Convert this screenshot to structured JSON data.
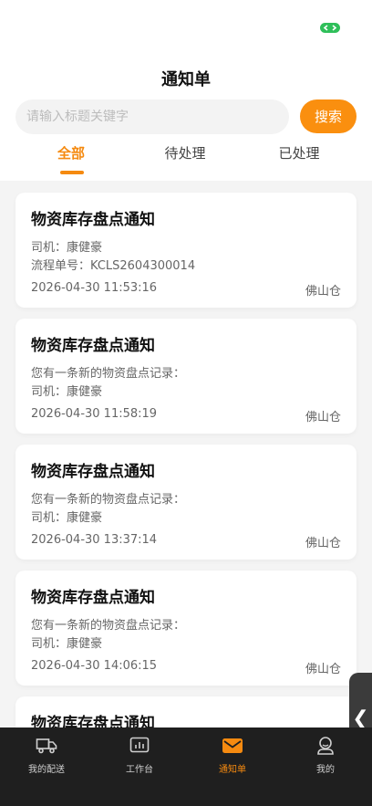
{
  "nav": {
    "title": "通知单"
  },
  "search": {
    "placeholder": "请输入标题关键字",
    "value": "",
    "button_label": "搜索"
  },
  "tabs": [
    {
      "label": "全部",
      "active": true
    },
    {
      "label": "待处理",
      "active": false
    },
    {
      "label": "已处理",
      "active": false
    }
  ],
  "cards": [
    {
      "title": "物资库存盘点通知",
      "line1": "司机：康健豪",
      "line2": "流程单号：KCLS2604300014",
      "time": "2026-04-30 11:53:16",
      "warehouse": "佛山仓"
    },
    {
      "title": "物资库存盘点通知",
      "line1": "您有一条新的物资盘点记录：",
      "line2": "司机：康健豪",
      "time": "2026-04-30 11:58:19",
      "warehouse": "佛山仓"
    },
    {
      "title": "物资库存盘点通知",
      "line1": "您有一条新的物资盘点记录：",
      "line2": "司机：康健豪",
      "time": "2026-04-30 13:37:14",
      "warehouse": "佛山仓"
    },
    {
      "title": "物资库存盘点通知",
      "line1": "您有一条新的物资盘点记录：",
      "line2": "司机：康健豪",
      "time": "2026-04-30 14:06:15",
      "warehouse": "佛山仓"
    },
    {
      "title": "物资库存盘点通知",
      "line1": "",
      "line2": "",
      "time": "",
      "warehouse": ""
    }
  ],
  "side_handle": {
    "glyph": "❮"
  },
  "tabbar": [
    {
      "label": "我的配送",
      "icon": "truck-icon",
      "active": false
    },
    {
      "label": "工作台",
      "icon": "dashboard-icon",
      "active": false
    },
    {
      "label": "通知单",
      "icon": "envelope-icon",
      "active": true
    },
    {
      "label": "我的",
      "icon": "user-icon",
      "active": false
    }
  ],
  "colors": {
    "accent": "#f58a10",
    "search_button": "#fa8f0f",
    "tabbar_bg": "#1f1f1f",
    "battery": "#2fbf5a"
  }
}
